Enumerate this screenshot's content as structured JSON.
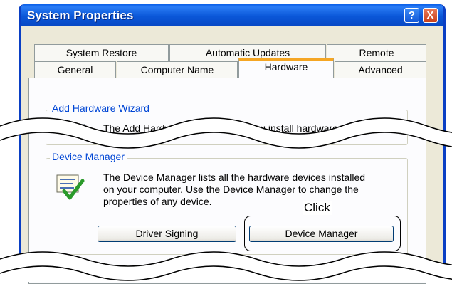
{
  "window": {
    "title": "System Properties"
  },
  "titlebar_buttons": {
    "help": "?",
    "close": "X"
  },
  "tabs_back": [
    "System Restore",
    "Automatic Updates",
    "Remote"
  ],
  "tabs_front": [
    "General",
    "Computer Name",
    "Hardware",
    "Advanced"
  ],
  "active_tab": "Hardware",
  "add_hardware": {
    "label": "Add Hardware Wizard",
    "text": "The Add Hardware Wizard helps you install hardware."
  },
  "device_manager": {
    "label": "Device Manager",
    "text_line1": "The Device Manager lists all the hardware devices installed",
    "text_line2": "on your computer. Use the Device Manager to change the",
    "text_line3": "properties of any device.",
    "driver_signing_button": "Driver Signing",
    "device_manager_button": "Device Manager"
  },
  "annotation": {
    "click_label": "Click"
  },
  "colors": {
    "title_bar": "#0a57d8",
    "group_label": "#0046d5",
    "tab_highlight": "#f5a623",
    "close_button": "#c9401a"
  },
  "icons": [
    "help-icon",
    "close-icon",
    "add-hardware-icon",
    "device-manager-icon"
  ]
}
